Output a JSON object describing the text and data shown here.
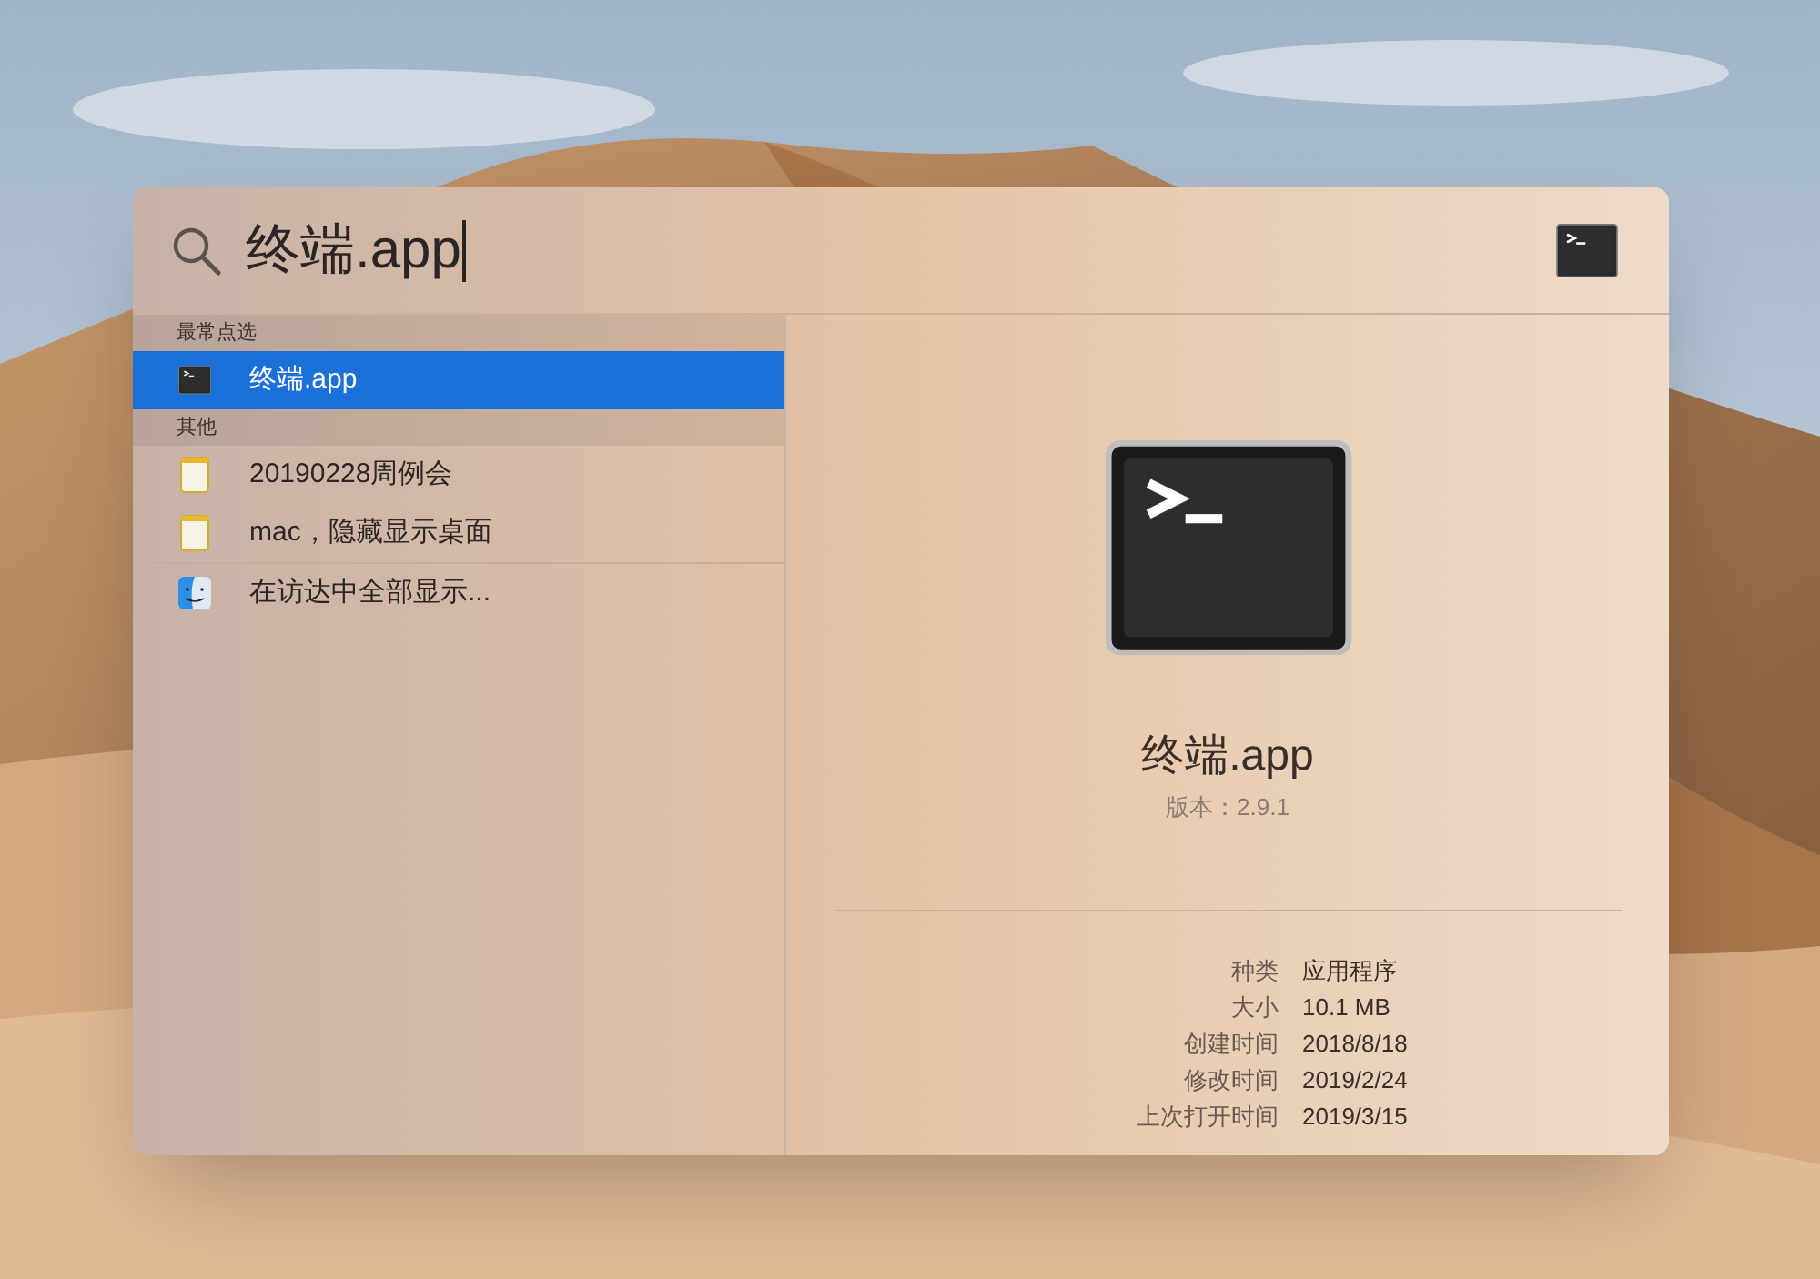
{
  "search": {
    "value": "终端.app"
  },
  "sections": [
    {
      "title": "最常点选",
      "items": [
        {
          "label": "终端.app",
          "kind": "terminal",
          "selected": true
        }
      ]
    },
    {
      "title": "其他",
      "items": [
        {
          "label": "20190228周例会",
          "kind": "note",
          "selected": false
        },
        {
          "label": "mac，隐藏显示桌面",
          "kind": "note",
          "selected": false
        }
      ]
    }
  ],
  "show_all": {
    "label": "在访达中全部显示...",
    "kind": "finder"
  },
  "preview": {
    "title": "终端.app",
    "version": "版本：2.9.1",
    "details": [
      {
        "label": "种类",
        "value": "应用程序"
      },
      {
        "label": "大小",
        "value": "10.1 MB"
      },
      {
        "label": "创建时间",
        "value": "2018/8/18"
      },
      {
        "label": "修改时间",
        "value": "2019/2/24"
      },
      {
        "label": "上次打开时间",
        "value": "2019/3/15"
      }
    ]
  }
}
